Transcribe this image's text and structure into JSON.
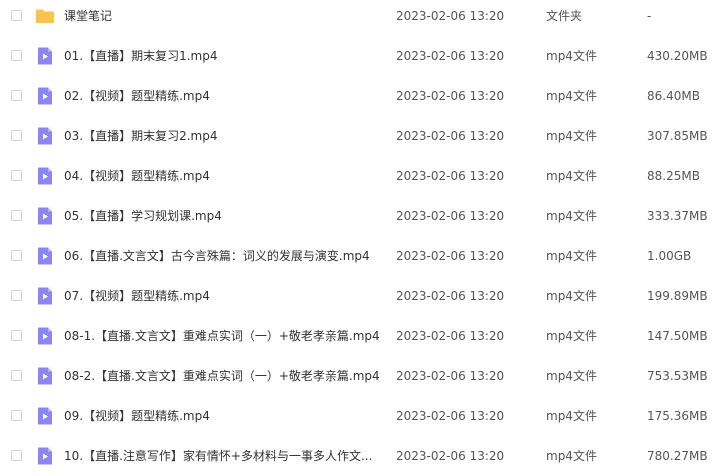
{
  "colors": {
    "folder_icon": "#f8c44e",
    "video_icon": "#8c86f4",
    "text_primary": "#333333",
    "text_secondary": "#555555"
  },
  "files": [
    {
      "name": "课堂笔记",
      "date": "2023-02-06 13:20",
      "type": "文件夹",
      "size": "-",
      "icon": "folder-icon"
    },
    {
      "name": "01.【直播】期末复习1.mp4",
      "date": "2023-02-06 13:20",
      "type": "mp4文件",
      "size": "430.20MB",
      "icon": "video-file-icon"
    },
    {
      "name": "02.【视频】题型精练.mp4",
      "date": "2023-02-06 13:20",
      "type": "mp4文件",
      "size": "86.40MB",
      "icon": "video-file-icon"
    },
    {
      "name": "03.【直播】期末复习2.mp4",
      "date": "2023-02-06 13:20",
      "type": "mp4文件",
      "size": "307.85MB",
      "icon": "video-file-icon"
    },
    {
      "name": "04.【视频】题型精练.mp4",
      "date": "2023-02-06 13:20",
      "type": "mp4文件",
      "size": "88.25MB",
      "icon": "video-file-icon"
    },
    {
      "name": "05.【直播】学习规划课.mp4",
      "date": "2023-02-06 13:20",
      "type": "mp4文件",
      "size": "333.37MB",
      "icon": "video-file-icon"
    },
    {
      "name": "06.【直播.文言文】古今言殊篇：词义的发展与演变.mp4",
      "date": "2023-02-06 13:20",
      "type": "mp4文件",
      "size": "1.00GB",
      "icon": "video-file-icon"
    },
    {
      "name": "07.【视频】题型精练.mp4",
      "date": "2023-02-06 13:20",
      "type": "mp4文件",
      "size": "199.89MB",
      "icon": "video-file-icon"
    },
    {
      "name": "08-1.【直播.文言文】重难点实词（一）+敬老孝亲篇.mp4",
      "date": "2023-02-06 13:20",
      "type": "mp4文件",
      "size": "147.50MB",
      "icon": "video-file-icon"
    },
    {
      "name": "08-2.【直播.文言文】重难点实词（一）+敬老孝亲篇.mp4",
      "date": "2023-02-06 13:20",
      "type": "mp4文件",
      "size": "753.53MB",
      "icon": "video-file-icon"
    },
    {
      "name": "09.【视频】题型精练.mp4",
      "date": "2023-02-06 13:20",
      "type": "mp4文件",
      "size": "175.36MB",
      "icon": "video-file-icon"
    },
    {
      "name": "10.【直播.注意写作】家有情怀+多材料与一事多人作文...",
      "date": "2023-02-06 13:20",
      "type": "mp4文件",
      "size": "780.27MB",
      "icon": "video-file-icon"
    }
  ]
}
